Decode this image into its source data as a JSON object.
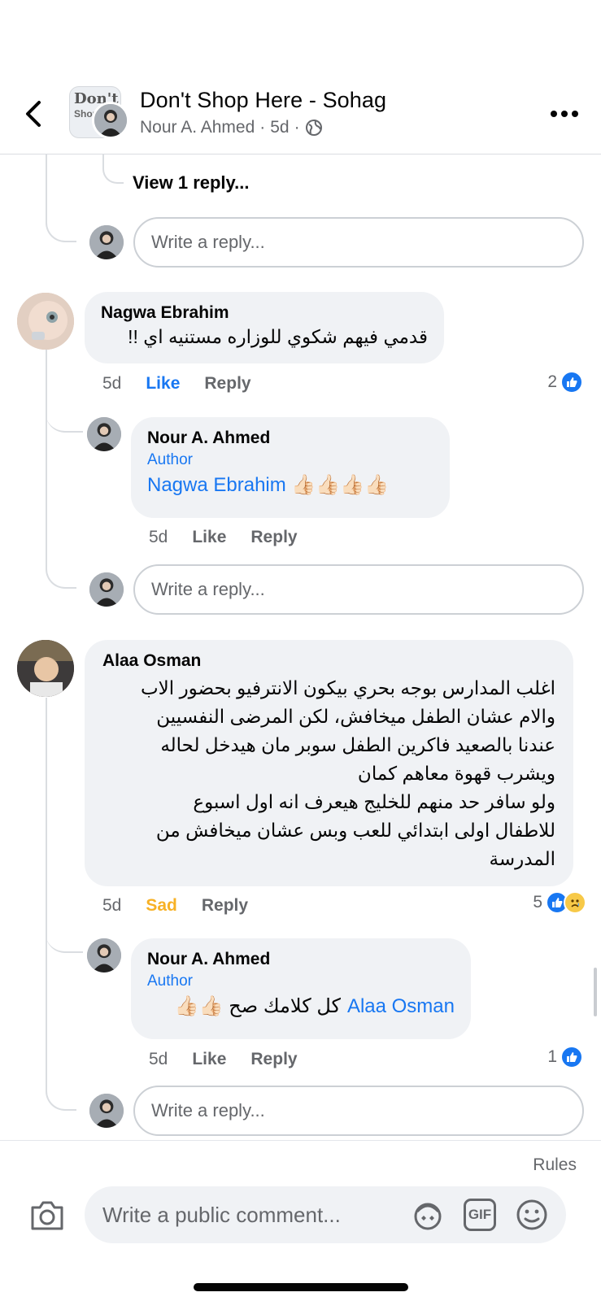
{
  "header": {
    "title": "Don't Shop Here - Sohag",
    "author": "Nour A. Ahmed",
    "time": "5d",
    "separator": "·",
    "thumb_line1": "Don't",
    "thumb_line2": "Shop"
  },
  "top_thread": {
    "view_replies": "View 1 reply...",
    "reply_placeholder": "Write a reply..."
  },
  "comments": [
    {
      "name": "Nagwa Ebrahim",
      "text": "قدمي فيهم شكوي للوزاره مستنيه اي !!",
      "time": "5d",
      "like_label": "Like",
      "reply_label": "Reply",
      "reaction_count": "2",
      "reply": {
        "name": "Nour A. Ahmed",
        "badge": "Author",
        "mention": "Nagwa Ebrahim",
        "text": "👍🏻👍🏻👍🏻👍🏻",
        "time": "5d",
        "like_label": "Like",
        "reply_label": "Reply"
      },
      "reply_placeholder": "Write a reply..."
    },
    {
      "name": "Alaa Osman",
      "lines": [
        "اغلب المدارس بوجه بحري بيكون الانترفيو بحضور الاب",
        "والام عشان الطفل ميخافش، لكن المرضى النفسيين",
        "عندنا بالصعيد فاكرين الطفل سوبر مان هيدخل لحاله",
        "ويشرب قهوة معاهم كمان",
        "ولو سافر حد منهم للخليج هيعرف انه اول اسبوع",
        "للاطفال اولى ابتدائي للعب وبس عشان ميخافش من",
        "المدرسة"
      ],
      "time": "5d",
      "reaction_label": "Sad",
      "reply_label": "Reply",
      "reaction_count": "5",
      "reply": {
        "name": "Nour A. Ahmed",
        "badge": "Author",
        "mention": "Alaa Osman",
        "text": "كل كلامك صح 👍🏻👍🏻",
        "time": "5d",
        "like_label": "Like",
        "reply_label": "Reply",
        "reaction_count": "1"
      },
      "reply_placeholder": "Write a reply..."
    }
  ],
  "footer": {
    "rules": "Rules",
    "comment_placeholder": "Write a public comment...",
    "gif_label": "GIF"
  },
  "colors": {
    "accent": "#1877f2",
    "sad": "#f7b125",
    "bubble": "#f0f2f5",
    "muted": "#65676b"
  }
}
